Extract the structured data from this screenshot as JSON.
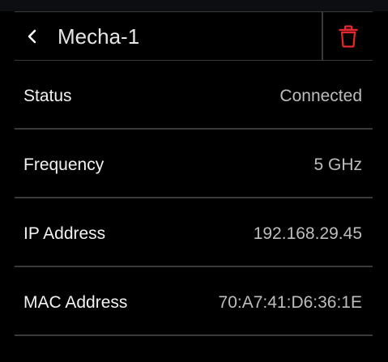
{
  "header": {
    "back_icon": "chevron-left-icon",
    "title": "Mecha-1",
    "delete_icon": "trash-icon",
    "delete_color": "#e8272d"
  },
  "details": [
    {
      "label": "Status",
      "value": "Connected"
    },
    {
      "label": "Frequency",
      "value": "5 GHz"
    },
    {
      "label": "IP Address",
      "value": "192.168.29.45"
    },
    {
      "label": "MAC Address",
      "value": "70:A7:41:D6:36:1E"
    }
  ]
}
